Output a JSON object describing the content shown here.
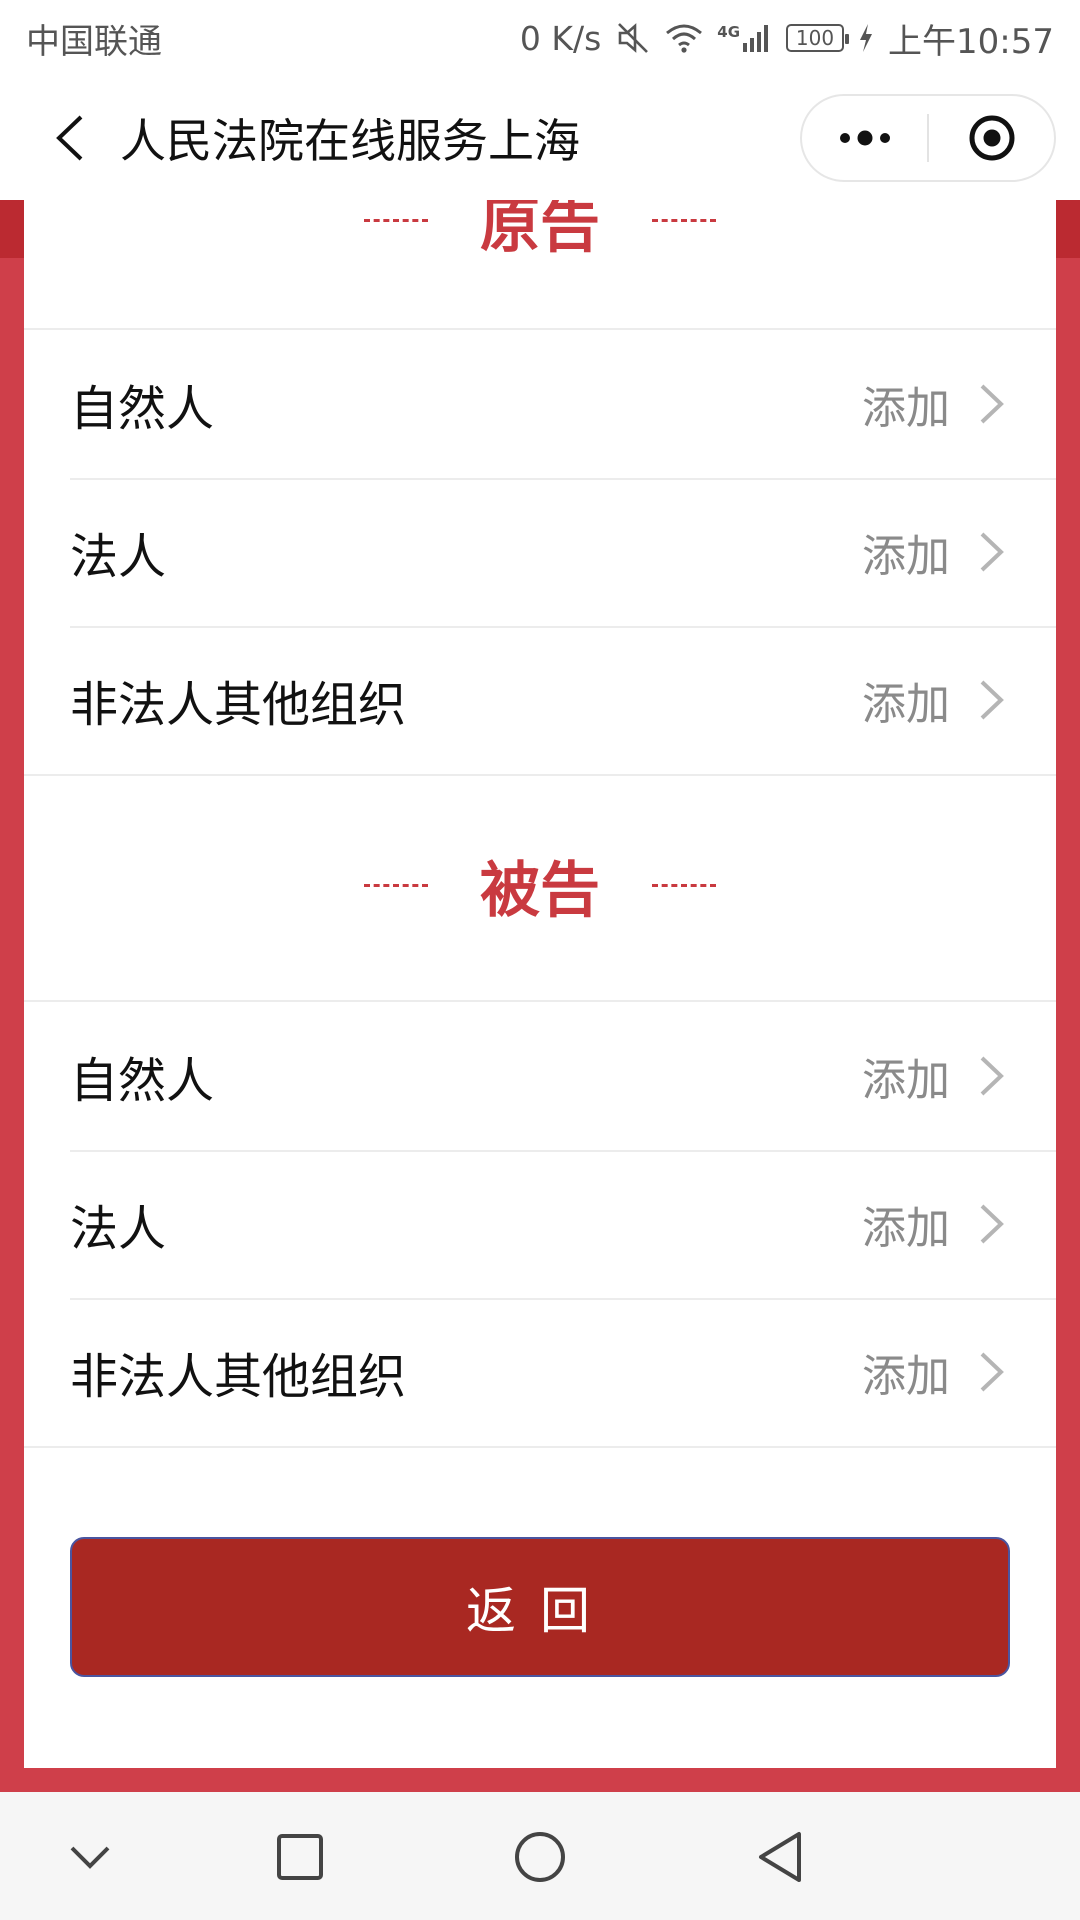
{
  "status_bar": {
    "carrier": "中国联通",
    "speed": "0 K/s",
    "network": "4G",
    "battery": "100",
    "time": "上午10:57"
  },
  "nav": {
    "title": "人民法院在线服务上海"
  },
  "sections": [
    {
      "title": "原告",
      "rows": [
        {
          "label": "自然人",
          "action": "添加"
        },
        {
          "label": "法人",
          "action": "添加"
        },
        {
          "label": "非法人其他组织",
          "action": "添加"
        }
      ]
    },
    {
      "title": "被告",
      "rows": [
        {
          "label": "自然人",
          "action": "添加"
        },
        {
          "label": "法人",
          "action": "添加"
        },
        {
          "label": "非法人其他组织",
          "action": "添加"
        }
      ]
    }
  ],
  "return_button": "返回",
  "colors": {
    "accent": "#c93a40",
    "page_background": "#cf3f4a",
    "button": "#a92822"
  },
  "icons": [
    "back-chevron-icon",
    "more-dots-icon",
    "close-target-icon",
    "chevron-right-icon",
    "nav-down-icon",
    "nav-square-icon",
    "nav-circle-icon",
    "nav-triangle-icon"
  ]
}
